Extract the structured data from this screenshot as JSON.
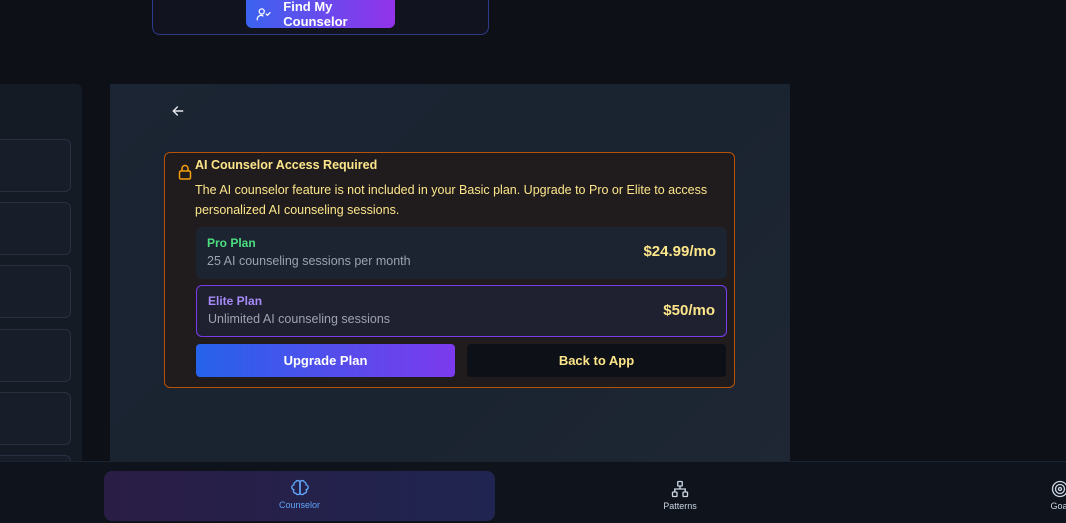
{
  "header": {
    "find_counselor_label": "Find My Counselor"
  },
  "notice": {
    "title": "AI Counselor Access Required",
    "description": "The AI counselor feature is not included in your Basic plan. Upgrade to Pro or Elite to access personalized AI counseling sessions."
  },
  "plans": [
    {
      "name": "Pro Plan",
      "description": "25 AI counseling sessions per month",
      "price": "$24.99/mo"
    },
    {
      "name": "Elite Plan",
      "description": "Unlimited AI counseling sessions",
      "price": "$50/mo"
    }
  ],
  "actions": {
    "upgrade_label": "Upgrade Plan",
    "back_label": "Back to App"
  },
  "bottom_nav": {
    "items": [
      {
        "label": "Counselor",
        "icon": "brain-icon",
        "active": true
      },
      {
        "label": "Patterns",
        "icon": "network-icon",
        "active": false
      },
      {
        "label": "Goal",
        "icon": "target-icon",
        "active": false
      }
    ]
  },
  "colors": {
    "accent_gradient_start": "#2563eb",
    "accent_gradient_end": "#7c3aed",
    "warning_border": "#b45309",
    "warning_text": "#fde68a",
    "pro_plan_green": "#4ade80",
    "elite_plan_purple": "#a78bfa",
    "active_nav_blue": "#60a5fa"
  }
}
